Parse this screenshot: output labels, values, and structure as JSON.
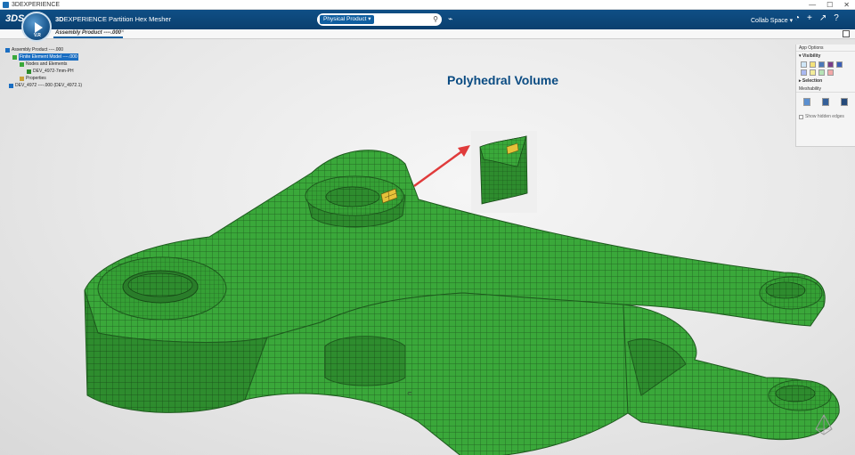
{
  "window": {
    "title": "3DEXPERIENCE",
    "controls": [
      "—",
      "☐",
      "✕"
    ]
  },
  "topbar": {
    "logo": "3DS",
    "compass_version": "V.R",
    "brand": "3D",
    "brand_rest": "EXPERIENCE",
    "app_name": "Partition Hex Mesher",
    "search_chip": "Physical Product ▾",
    "collab_space": "Collab Space ▾",
    "accent": "#0f4f86"
  },
  "tabbar": {
    "active_tab": "Assembly Product ----.000",
    "close": "×"
  },
  "tree": {
    "items": [
      {
        "label": "Assembly Product ----.000"
      },
      {
        "label": "Finite Element Model ----.000"
      },
      {
        "label": "Nodes and Elements"
      },
      {
        "label": "DEV_4972-7mm-PH"
      },
      {
        "label": "Properties"
      },
      {
        "label": "DEV_4972 ----.000 (DEV_4972.1)"
      }
    ]
  },
  "callout": {
    "title": "Polyhedral Volume"
  },
  "panel": {
    "header": "App Options",
    "visibility": "▾ Visibility",
    "selection": "▸ Selection",
    "meshability": "Meshability",
    "show_hidden_edges": "Show hidden edges"
  },
  "colors": {
    "mesh_green": "#3aa83a",
    "highlight": "#e6c23a",
    "arrow": "#e03b3b"
  }
}
